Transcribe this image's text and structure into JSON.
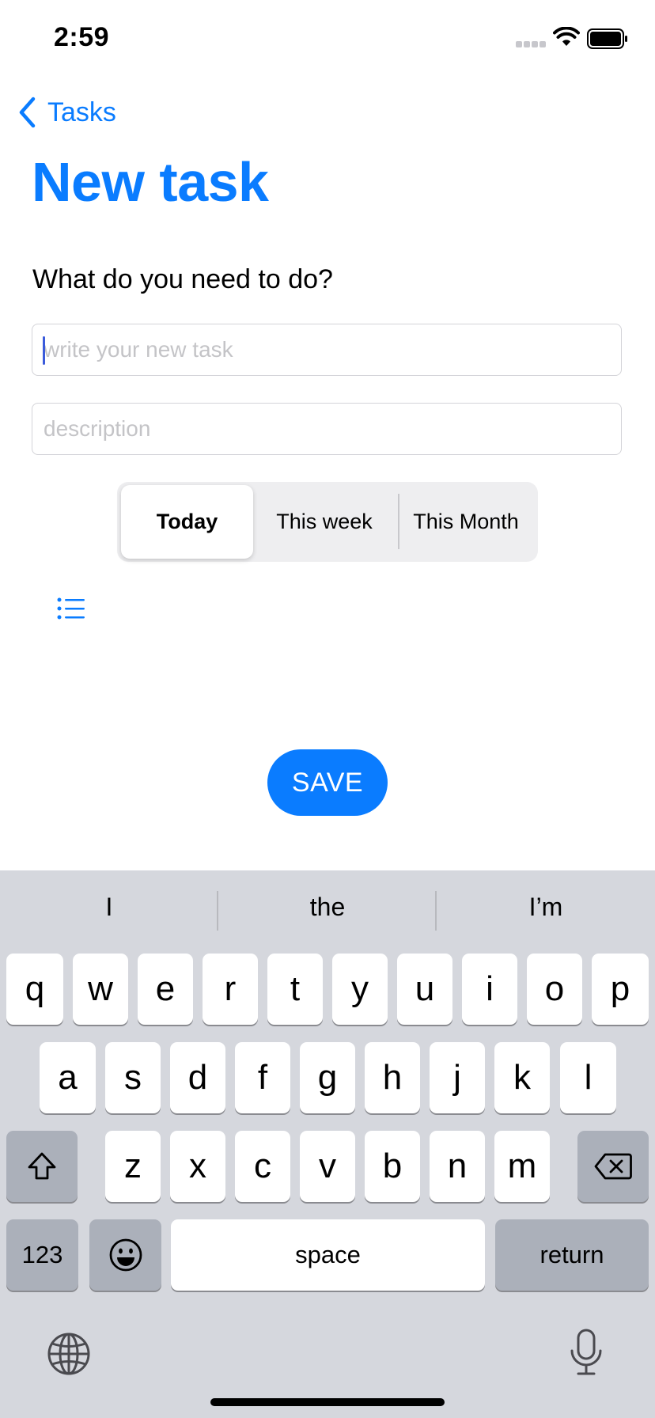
{
  "status_bar": {
    "time": "2:59"
  },
  "nav": {
    "back_label": "Tasks",
    "title": "New task"
  },
  "form": {
    "prompt": "What do you need to do?",
    "task_placeholder": "write your new task",
    "description_placeholder": "description"
  },
  "segments": [
    {
      "label": "Today",
      "selected": true
    },
    {
      "label": "This week",
      "selected": false
    },
    {
      "label": "This Month",
      "selected": false
    }
  ],
  "save_label": "SAVE",
  "keyboard": {
    "suggestions": [
      "I",
      "the",
      "I’m"
    ],
    "row1": [
      "q",
      "w",
      "e",
      "r",
      "t",
      "y",
      "u",
      "i",
      "o",
      "p"
    ],
    "row2": [
      "a",
      "s",
      "d",
      "f",
      "g",
      "h",
      "j",
      "k",
      "l"
    ],
    "row3": [
      "z",
      "x",
      "c",
      "v",
      "b",
      "n",
      "m"
    ],
    "numbers_label": "123",
    "space_label": "space",
    "return_label": "return"
  },
  "colors": {
    "accent": "#0a7cff",
    "keyboard_bg": "#d5d7dd",
    "dark_key": "#abb0ba"
  },
  "icons": [
    "back-chevron-icon",
    "wifi-icon",
    "battery-icon",
    "list-icon",
    "shift-icon",
    "delete-icon",
    "emoji-icon",
    "globe-icon",
    "microphone-icon"
  ]
}
